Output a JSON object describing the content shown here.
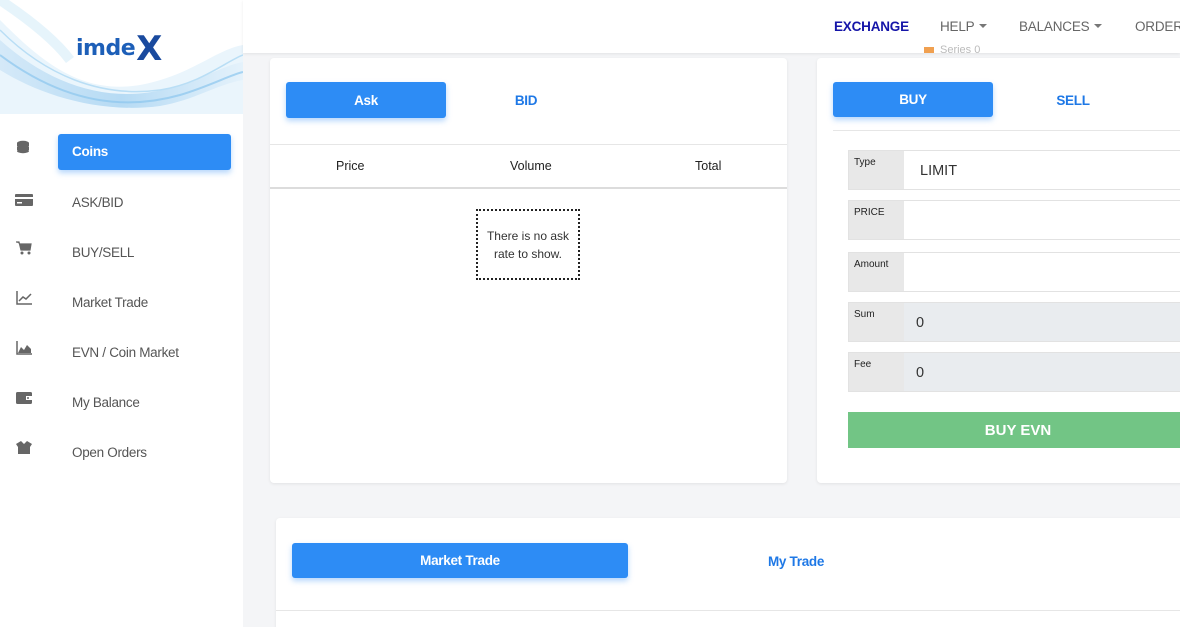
{
  "brand": {
    "name": "imde",
    "name_x": "X"
  },
  "topnav": {
    "exchange": "EXCHANGE",
    "help": "HELP",
    "balances": "BALANCES",
    "orders": "ORDER"
  },
  "legend_fragment": "Series 0",
  "sidebar": {
    "items": [
      {
        "label": "Coins",
        "icon": "coins-icon"
      },
      {
        "label": "ASK/BID",
        "icon": "card-icon"
      },
      {
        "label": "BUY/SELL",
        "icon": "cart-icon"
      },
      {
        "label": "Market Trade",
        "icon": "line-chart-icon"
      },
      {
        "label": "EVN / Coin Market",
        "icon": "area-chart-icon"
      },
      {
        "label": "My Balance",
        "icon": "wallet-icon"
      },
      {
        "label": "Open Orders",
        "icon": "box-icon"
      }
    ]
  },
  "orderbook": {
    "tab_ask": "Ask",
    "tab_bid": "BID",
    "columns": [
      "Price",
      "Volume",
      "Total"
    ],
    "empty_message": "There is no ask rate to show."
  },
  "order_form": {
    "tab_buy": "BUY",
    "tab_sell": "SELL",
    "type_label": "Type",
    "type_value": "LIMIT",
    "price_label": "PRICE",
    "price_value": "",
    "amount_label": "Amount",
    "amount_value": "",
    "sum_label": "Sum",
    "sum_value": "0",
    "fee_label": "Fee",
    "fee_value": "0",
    "submit_label": "BUY EVN"
  },
  "trades": {
    "tab_market": "Market Trade",
    "tab_my": "My Trade"
  },
  "colors": {
    "primary": "#2d8cf5",
    "link": "#1e78e6",
    "exchange_active": "#1515a8",
    "buy_button": "#72c585"
  }
}
